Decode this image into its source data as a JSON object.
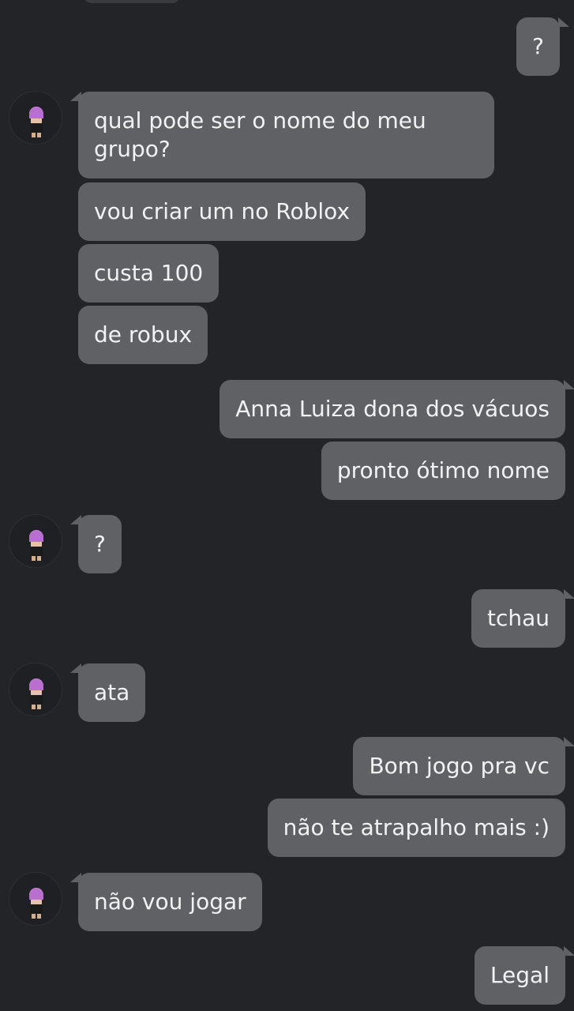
{
  "messages": [
    {
      "from": "me",
      "text": "?"
    },
    {
      "from": "friend",
      "text": "qual pode ser o nome do meu grupo?"
    },
    {
      "from": "friend",
      "text": "vou criar um no Roblox"
    },
    {
      "from": "friend",
      "text": "custa 100"
    },
    {
      "from": "friend",
      "text": "de robux"
    },
    {
      "from": "me",
      "text": "Anna Luiza dona dos vácuos"
    },
    {
      "from": "me",
      "text": "pronto ótimo nome"
    },
    {
      "from": "friend",
      "text": "?"
    },
    {
      "from": "me",
      "text": "tchau"
    },
    {
      "from": "friend",
      "text": "ata"
    },
    {
      "from": "me",
      "text": "Bom jogo pra vc"
    },
    {
      "from": "me",
      "text": "não te atrapalho mais :)"
    },
    {
      "from": "friend",
      "text": "não vou jogar"
    },
    {
      "from": "me",
      "text": "Legal"
    }
  ],
  "colors": {
    "background": "#232427",
    "bubble": "#606165",
    "text": "#f2f2f2",
    "avatar_hair": "#c77fd6"
  },
  "icons": {
    "avatar": "roblox-avatar-icon"
  }
}
